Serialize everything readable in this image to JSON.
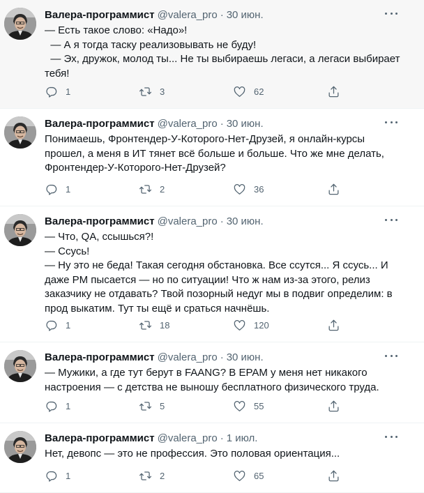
{
  "tweets": [
    {
      "author": "Валера-программист",
      "handle": "@valera_pro",
      "separator": "·",
      "date": "30 июн.",
      "lines": [
        "— Есть такое слово: «Надо»!",
        "  — А я тогда таску реализовывать не буду!",
        "  — Эх, дружок, молод ты... Не ты выбираешь легаси, а легаси выбирает",
        "тебя!"
      ],
      "replies": "1",
      "retweets": "3",
      "likes": "62"
    },
    {
      "author": "Валера-программист",
      "handle": "@valera_pro",
      "separator": "·",
      "date": "30 июн.",
      "lines": [
        "Понимаешь, Фронтендер-У-Которого-Нет-Друзей, я онлайн-курсы",
        "прошел, а меня в ИТ тянет всё больше и больше. Что же мне делать,",
        "Фронтендер-У-Которого-Нет-Друзей?"
      ],
      "replies": "1",
      "retweets": "2",
      "likes": "36"
    },
    {
      "author": "Валера-программист",
      "handle": "@valera_pro",
      "separator": "·",
      "date": "30 июн.",
      "lines": [
        "— Что, QA, ссышься?!",
        "— Ссусь!",
        "— Ну это не беда! Такая сегодня обстановка. Все ссутся... Я ссусь... И",
        "даже PM пысается — но по ситуации! Что ж нам из-за этого, релиз",
        "заказчику не отдавать? Твой позорный недуг мы в подвиг определим: в",
        "прод выкатим. Тут ты ещё и сраться начнёшь."
      ],
      "replies": "1",
      "retweets": "18",
      "likes": "120"
    },
    {
      "author": "Валера-программист",
      "handle": "@valera_pro",
      "separator": "·",
      "date": "30 июн.",
      "lines": [
        "— Мужики, а где тут берут в FAANG? В EPAM у меня нет никакого",
        "настроения — с детства не выношу бесплатного физического труда."
      ],
      "replies": "1",
      "retweets": "5",
      "likes": "55"
    },
    {
      "author": "Валера-программист",
      "handle": "@valera_pro",
      "separator": "·",
      "date": "1 июл.",
      "lines": [
        "Нет, девопс — это не профессия. Это половая ориентация..."
      ],
      "replies": "1",
      "retweets": "2",
      "likes": "65"
    }
  ],
  "icons": {
    "reply": "reply-icon",
    "retweet": "retweet-icon",
    "like": "heart-icon",
    "share": "share-icon",
    "more": "more-icon"
  },
  "colors": {
    "text": "#0f1419",
    "secondary": "#536471",
    "highlight_bg": "#f7f7f7",
    "divider": "#eff3f4"
  }
}
